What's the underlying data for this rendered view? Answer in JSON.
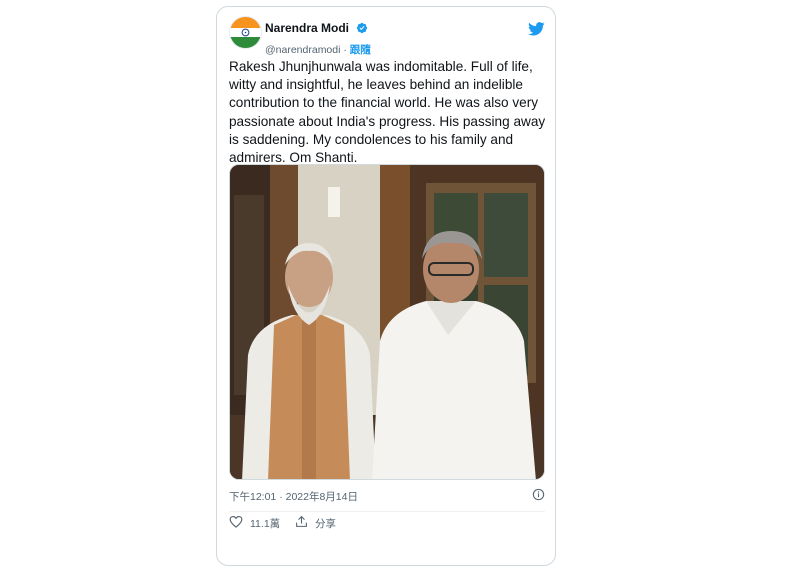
{
  "tweet": {
    "display_name": "Narendra Modi",
    "handle": "@narendramodi",
    "separator": "·",
    "follow_label": "跟隨",
    "text": "Rakesh Jhunjhunwala was indomitable. Full of life, witty and insightful, he leaves behind an indelible contribution to the financial world. He was also very passionate about India's progress. His passing away is saddening. My condolences to his family and admirers. Om Shanti.",
    "timestamp": "下午12:01 · 2022年8月14日",
    "likes": "11.1萬",
    "share_label": "分享"
  },
  "icons": {
    "verified": "verified-badge-icon",
    "brand": "twitter-bird-icon",
    "info": "info-icon",
    "like": "heart-icon",
    "share": "share-icon"
  },
  "colors": {
    "accent": "#1d9bf0",
    "text": "#0f1419",
    "muted": "#536471",
    "border": "#cfd9de"
  }
}
